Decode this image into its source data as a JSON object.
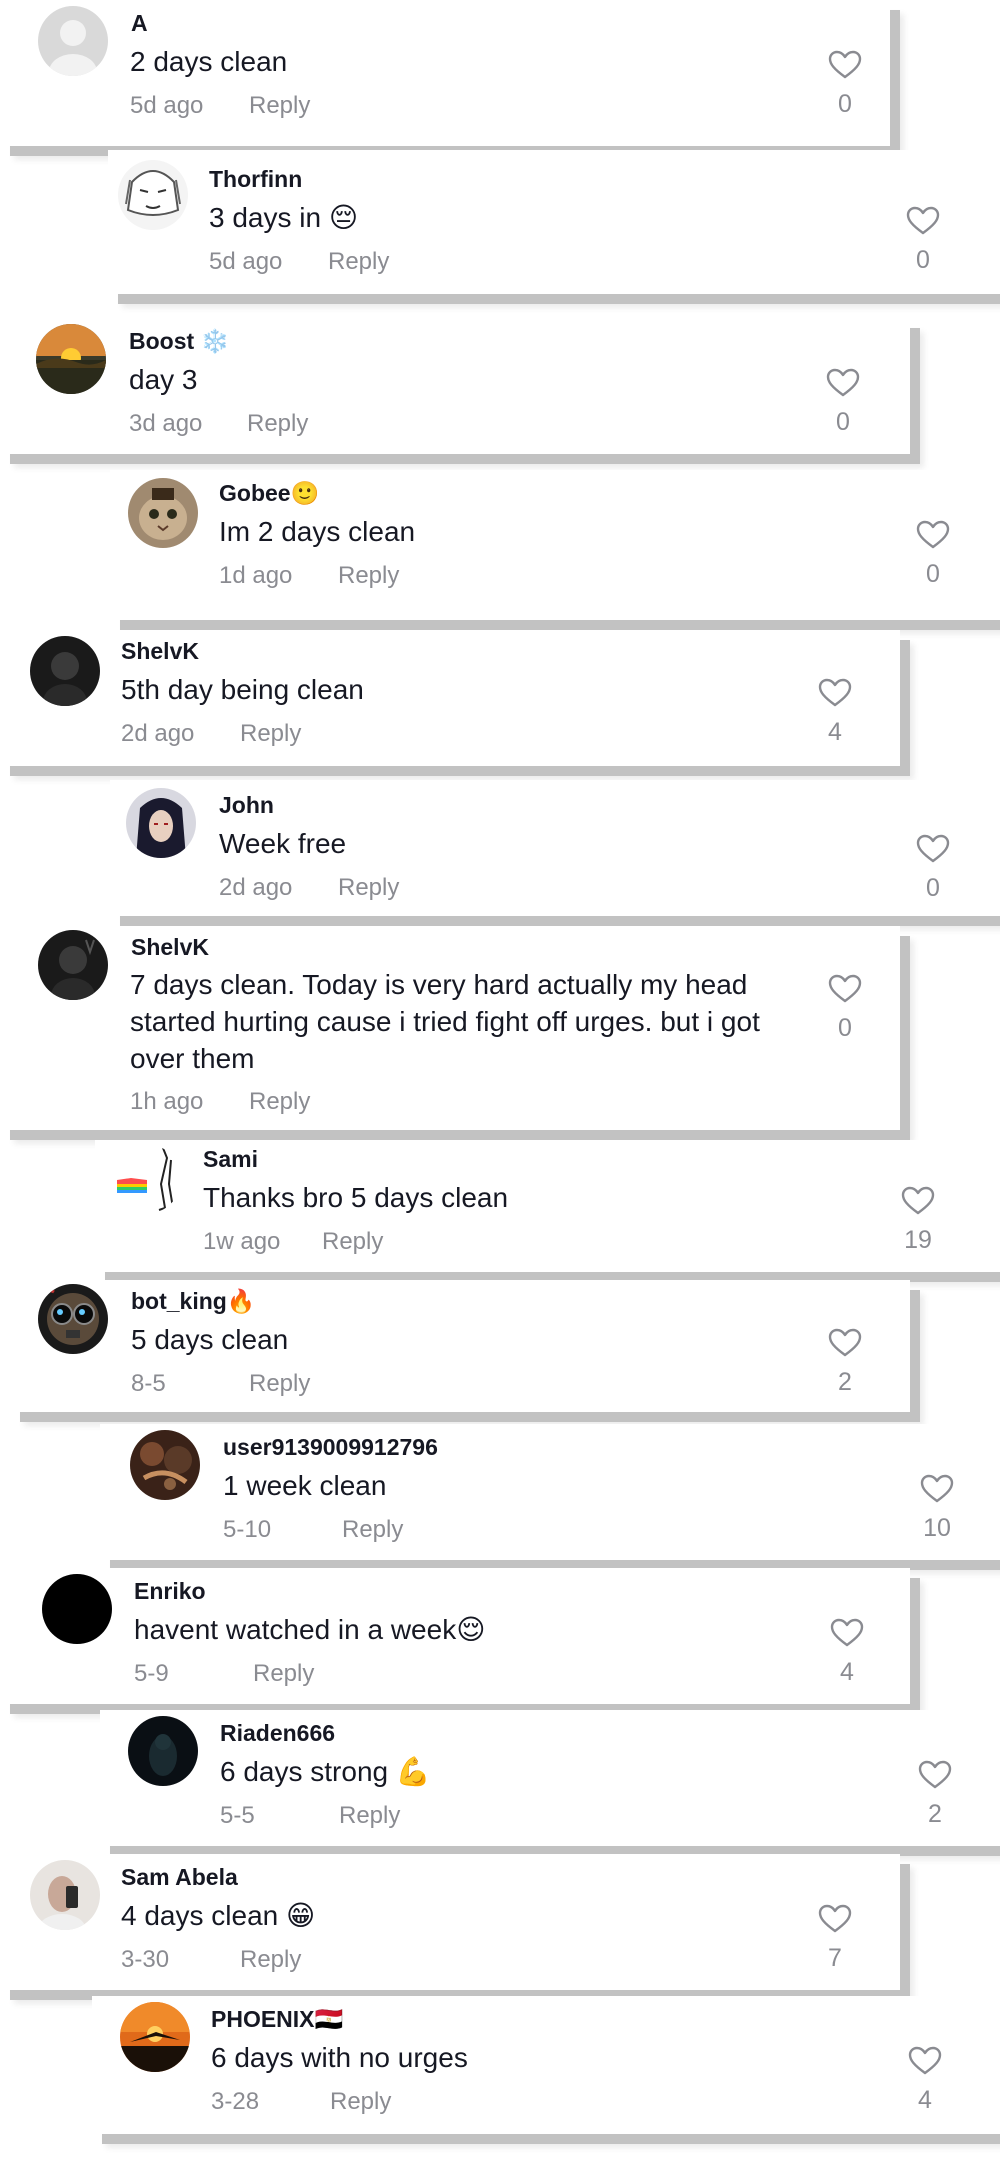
{
  "comments": [
    {
      "user": "A",
      "text": "2 days clean",
      "time": "5d ago",
      "reply": "Reply",
      "likes": "0"
    },
    {
      "user": "Thorfinn",
      "text": "3 days in 😔",
      "time": "5d ago",
      "reply": "Reply",
      "likes": "0"
    },
    {
      "user": "Boost ❄️",
      "text": "day 3",
      "time": "3d ago",
      "reply": "Reply",
      "likes": "0"
    },
    {
      "user": "Gobee🙂",
      "text": "Im 2 days clean",
      "time": "1d ago",
      "reply": "Reply",
      "likes": "0"
    },
    {
      "user": "ShelvK",
      "text": "5th day being clean",
      "time": "2d ago",
      "reply": "Reply",
      "likes": "4"
    },
    {
      "user": "John",
      "text": "Week free",
      "time": "2d ago",
      "reply": "Reply",
      "likes": "0"
    },
    {
      "user": "ShelvK",
      "text": "7 days clean. Today is very hard actually my head started hurting cause i tried fight off urges. but i got over them",
      "time": "1h ago",
      "reply": "Reply",
      "likes": "0"
    },
    {
      "user": "Sami",
      "text": "Thanks bro 5 days clean",
      "time": "1w ago",
      "reply": "Reply",
      "likes": "19"
    },
    {
      "user": "bot_king🔥",
      "text": "5 days clean",
      "time": "8-5",
      "reply": "Reply",
      "likes": "2"
    },
    {
      "user": "user9139009912796",
      "text": "1 week clean",
      "time": "5-10",
      "reply": "Reply",
      "likes": "10"
    },
    {
      "user": "Enriko",
      "text": "havent watched in a week😌",
      "time": "5-9",
      "reply": "Reply",
      "likes": "4"
    },
    {
      "user": "Riaden666",
      "text": "6 days strong 💪",
      "time": "5-5",
      "reply": "Reply",
      "likes": "2"
    },
    {
      "user": "Sam Abela",
      "text": "4 days clean 😁",
      "time": "3-30",
      "reply": "Reply",
      "likes": "7"
    },
    {
      "user": "PHOENIX🇪🇬",
      "text": "6 days with no urges",
      "time": "3-28",
      "reply": "Reply",
      "likes": "4"
    }
  ],
  "icons": {
    "like": "heart-outline-icon",
    "avatar": "profile-avatar"
  },
  "colors": {
    "text": "#161823",
    "muted": "#8a8b91",
    "shadow": "#c2c2c2"
  }
}
